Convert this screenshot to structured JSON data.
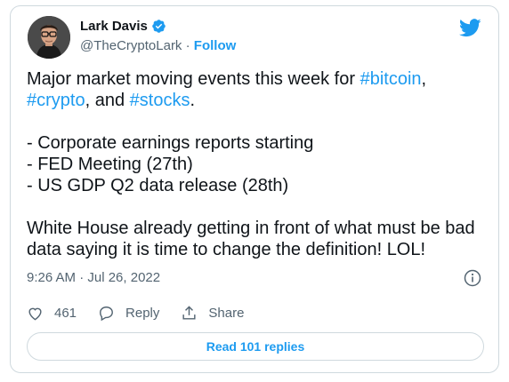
{
  "author": {
    "name": "Lark Davis",
    "handle": "@TheCryptoLark",
    "separator": "·",
    "follow_label": "Follow"
  },
  "tweet": {
    "line1_text": "Major market moving events this week for ",
    "hashtag_bitcoin": "#bitcoin",
    "line1_comma": ",",
    "hashtag_crypto": "#crypto",
    "line2_mid": ", and ",
    "hashtag_stocks": "#stocks",
    "line2_end": ".",
    "bullets": [
      "- Corporate earnings reports starting",
      "- FED Meeting (27th)",
      "- US GDP Q2 data release (28th)"
    ],
    "closing_line1": "White House already getting in front of what must be bad",
    "closing_line2": "data saying it is time to change the definition! LOL!"
  },
  "meta": {
    "timestamp": "9:26 AM · Jul 26, 2022"
  },
  "actions": {
    "likes_count": "461",
    "reply_label": "Reply",
    "share_label": "Share"
  },
  "footer": {
    "read_replies_label": "Read 101 replies"
  },
  "colors": {
    "accent": "#1d9bf0",
    "text": "#0f1419",
    "muted": "#536471",
    "border": "#cfd9de"
  }
}
